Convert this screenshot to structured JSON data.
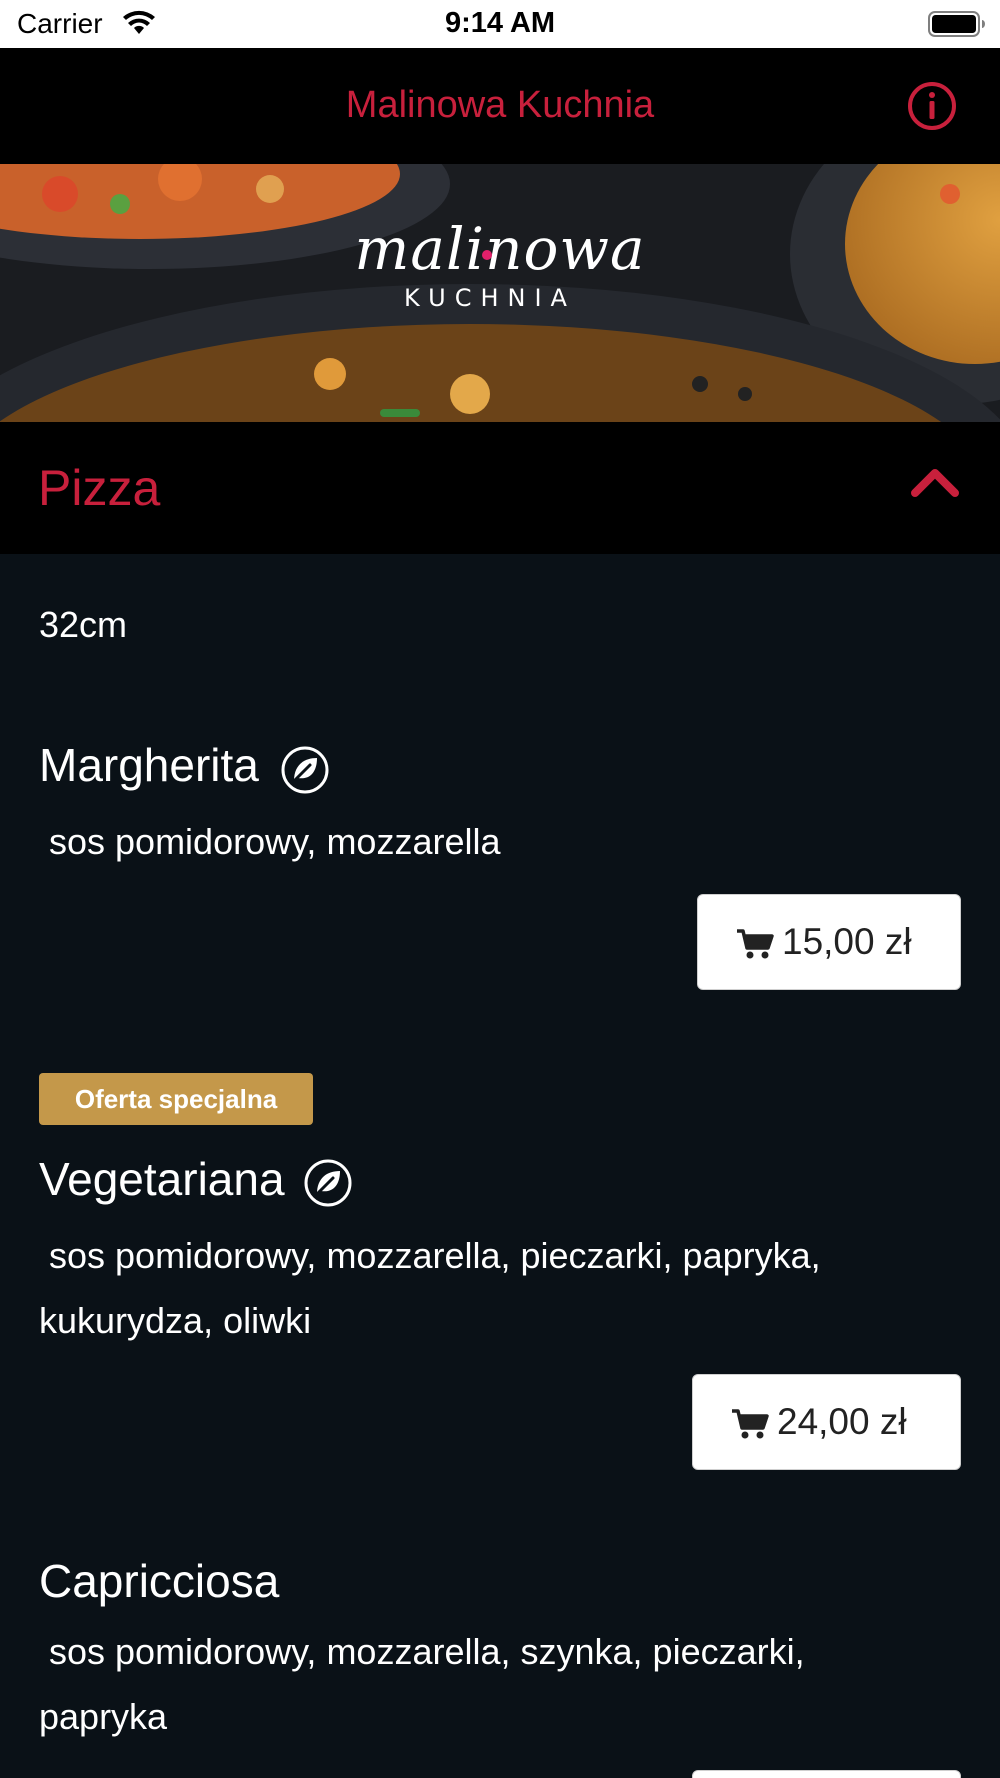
{
  "status_bar": {
    "carrier": "Carrier",
    "time": "9:14 AM"
  },
  "nav": {
    "title": "Malinowa Kuchnia",
    "info_icon": "info-circle-icon"
  },
  "banner": {
    "logo_script": "malinowa",
    "logo_sub": "KUCHNIA"
  },
  "category": {
    "title": "Pizza",
    "toggle_icon": "chevron-up-icon",
    "size_note": "32cm"
  },
  "dishes": [
    {
      "name": "Margherita",
      "vegetarian_icon": "leaf-icon",
      "description_lines": [
        " sos pomidorowy, mozzarella"
      ],
      "price": "15,00 zł"
    },
    {
      "badge": "Oferta specjalna",
      "name": "Vegetariana",
      "vegetarian_icon": "leaf-icon",
      "description_lines": [
        " sos pomidorowy, mozzarella, pieczarki, papryka,",
        "kukurydza, oliwki"
      ],
      "price": "24,00 zł"
    },
    {
      "name": "Capricciosa",
      "description_lines": [
        " sos pomidorowy, mozzarella, szynka, pieczarki,",
        "papryka"
      ]
    }
  ],
  "colors": {
    "accent": "#c8203c",
    "background": "#0a1117",
    "badge": "#c4984a"
  }
}
